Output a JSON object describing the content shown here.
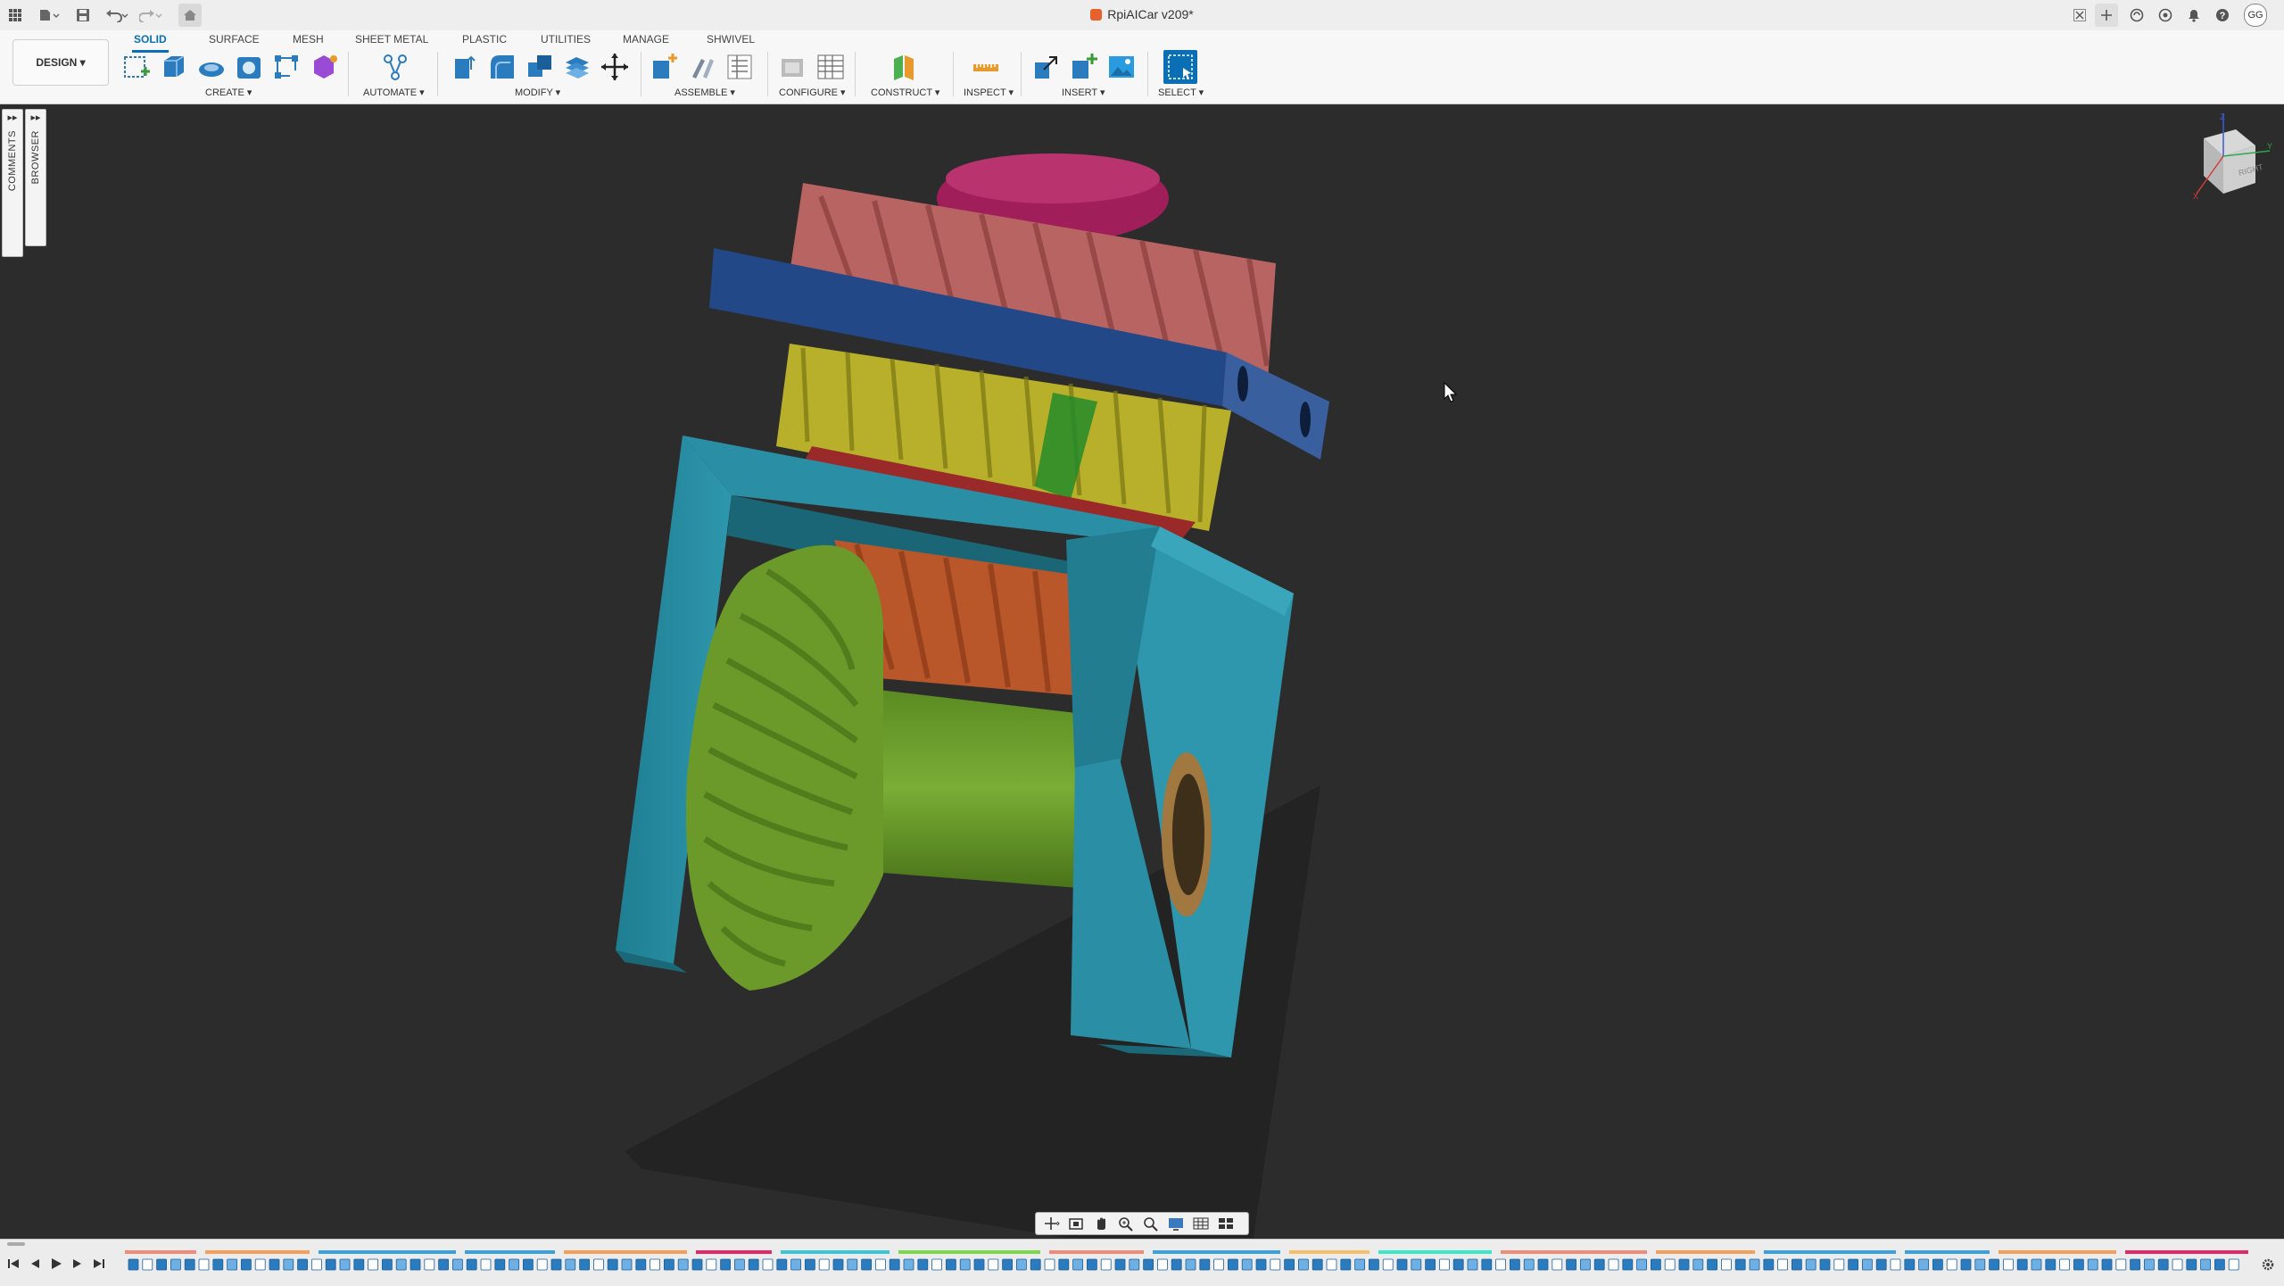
{
  "window": {
    "title": "RpiAICar v209*"
  },
  "user": {
    "initials": "GG"
  },
  "workspace": {
    "label": "DESIGN ▾"
  },
  "tabs": [
    {
      "label": "SOLID",
      "active": true
    },
    {
      "label": "SURFACE"
    },
    {
      "label": "MESH"
    },
    {
      "label": "SHEET METAL"
    },
    {
      "label": "PLASTIC"
    },
    {
      "label": "UTILITIES"
    },
    {
      "label": "MANAGE"
    },
    {
      "label": "SHWIVEL"
    }
  ],
  "groups": [
    {
      "label": "CREATE ▾"
    },
    {
      "label": "AUTOMATE ▾"
    },
    {
      "label": "MODIFY ▾"
    },
    {
      "label": "ASSEMBLE ▾"
    },
    {
      "label": "CONFIGURE ▾"
    },
    {
      "label": "CONSTRUCT ▾"
    },
    {
      "label": "INSPECT ▾"
    },
    {
      "label": "INSERT ▾"
    },
    {
      "label": "SELECT ▾"
    }
  ],
  "side_panels": {
    "comments": "COMMENTS",
    "browser": "BROWSER"
  },
  "viewcube": {
    "face_label": "RIGHT",
    "axes": [
      "X",
      "Y",
      "Z"
    ]
  },
  "colors": {
    "accent": "#0a6fb5",
    "viewport_bg": "#2c2c2c",
    "part_teal": "#2c8fa3",
    "part_green": "#6b9a2a",
    "part_yellow": "#bfb72a",
    "part_blue": "#2c4a8c",
    "part_salmon": "#c06b6b",
    "part_orange": "#c05a2a",
    "part_magenta": "#a01e5a"
  },
  "icons": {
    "titlebar": [
      "apps-grid-icon",
      "file-icon",
      "save-icon",
      "undo-icon",
      "redo-icon",
      "home-icon"
    ],
    "titlebar_right": [
      "close-tab-icon",
      "new-tab-icon",
      "extensions-icon",
      "job-status-icon",
      "notifications-icon",
      "help-icon"
    ]
  }
}
